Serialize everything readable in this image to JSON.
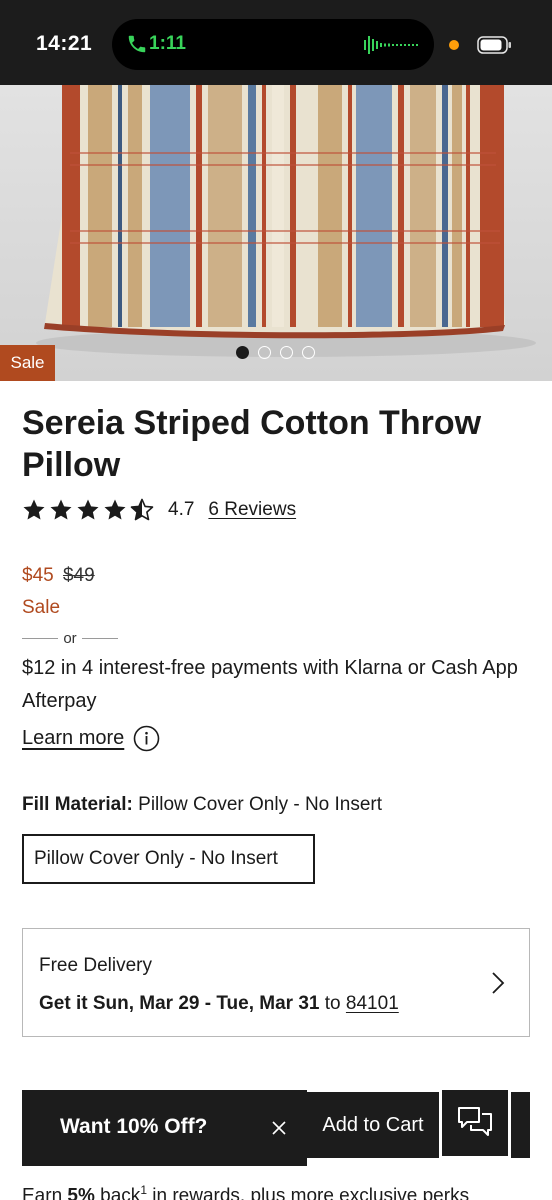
{
  "status_bar": {
    "time": "14:21",
    "call_timer": "1:11"
  },
  "gallery": {
    "badge": "Sale",
    "slide_count": 4,
    "active_slide": 1
  },
  "product": {
    "title": "Sereia Striped Cotton Throw Pillow",
    "rating": 4.7,
    "rating_text": "4.7",
    "reviews_label": "6 Reviews"
  },
  "pricing": {
    "sale_price": "$45",
    "original_price": "$49",
    "sale_label": "Sale",
    "or_label": "or",
    "installments": "$12 in 4 interest-free payments with Klarna or Cash App Afterpay",
    "learn_more": "Learn more"
  },
  "options": {
    "fill_label": "Fill Material:",
    "fill_value": "Pillow Cover Only - No Insert",
    "selected_option": "Pillow Cover Only - No Insert"
  },
  "delivery": {
    "title": "Free Delivery",
    "date_text": "Get it Sun, Mar 29 - Tue, Mar 31",
    "to_label": "to",
    "zip": "84101"
  },
  "bottom_bar": {
    "promo_text": "Want 10% Off?",
    "add_to_cart": "Add to Cart"
  },
  "rewards": {
    "prefix": "Earn",
    "percent": "5%",
    "suffix": "back",
    "footnote": "1",
    "rest": "in rewards, plus more exclusive perks"
  },
  "colors": {
    "sale": "#b04a1f",
    "dark": "#1c1c1c",
    "call_green": "#38d35a",
    "rec_orange": "#ff9f0a"
  }
}
